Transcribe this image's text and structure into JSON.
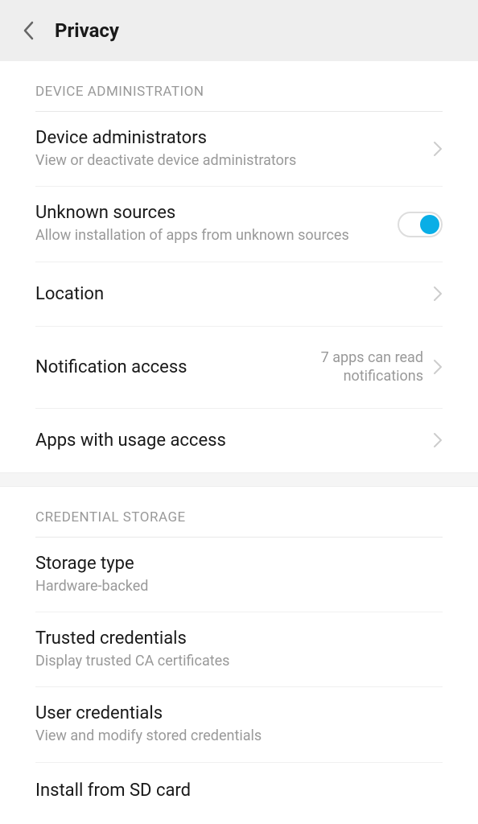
{
  "header": {
    "title": "Privacy"
  },
  "sections": {
    "device_admin": {
      "header": "DEVICE ADMINISTRATION",
      "device_administrators": {
        "title": "Device administrators",
        "subtitle": "View or deactivate device administrators"
      },
      "unknown_sources": {
        "title": "Unknown sources",
        "subtitle": "Allow installation of apps from unknown sources",
        "enabled": true
      },
      "location": {
        "title": "Location"
      },
      "notification_access": {
        "title": "Notification access",
        "value": "7 apps can read notifications"
      },
      "usage_access": {
        "title": "Apps with usage access"
      }
    },
    "credential_storage": {
      "header": "CREDENTIAL STORAGE",
      "storage_type": {
        "title": "Storage type",
        "subtitle": "Hardware-backed"
      },
      "trusted_credentials": {
        "title": "Trusted credentials",
        "subtitle": "Display trusted CA certificates"
      },
      "user_credentials": {
        "title": "User credentials",
        "subtitle": "View and modify stored credentials"
      },
      "install_sd": {
        "title": "Install from SD card"
      }
    }
  }
}
